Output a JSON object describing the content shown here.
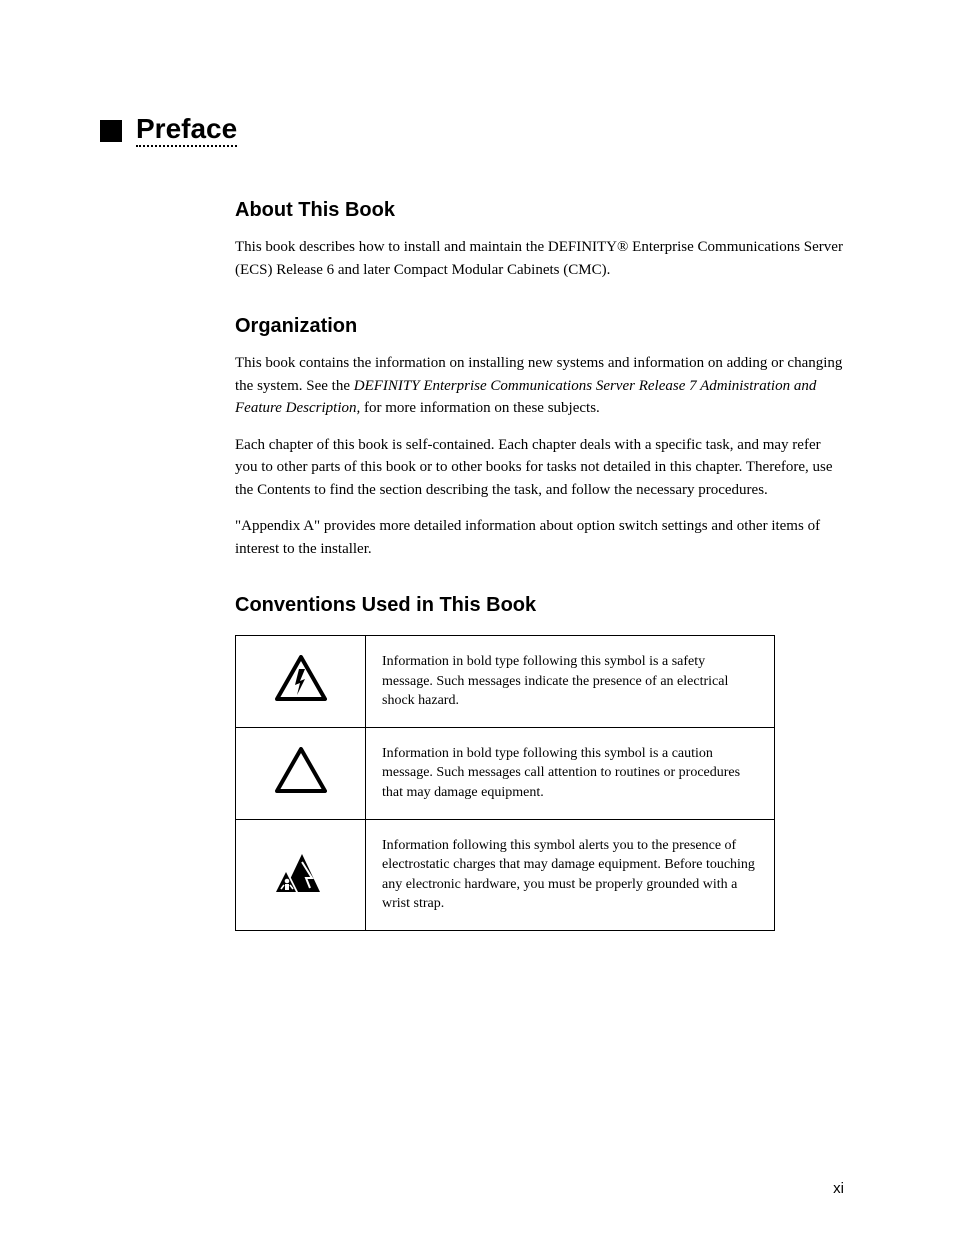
{
  "header": {
    "title": "Preface"
  },
  "intro": {
    "heading": "About This Book",
    "p1": "This book describes how to install and maintain the DEFINITY® Enterprise Communications Server (ECS) Release 6 and later Compact Modular Cabinets (CMC)."
  },
  "org": {
    "heading": "Organization",
    "p1_pre": "This book contains the information on installing new systems and information on adding or changing the system. See the ",
    "p1_em": "DEFINITY Enterprise Communications Server Release 7 Administration and Feature Description, ",
    "p1_post": "for more information on these subjects.",
    "p2_pre": "Each chapter of this book is self-contained. Each chapter deals with a specific task, and may refer you to other parts of this book or to other books for tasks not detailed in this chapter. Therefore, use the ",
    "p2_link": "Contents",
    "p2_post": " to find the section describing the task, and follow the necessary procedures.",
    "p3": "\"Appendix A\" provides more detailed information about option switch settings and other items of interest to the installer."
  },
  "conv": {
    "heading": "Conventions Used in This Book",
    "row1": "Information in bold type following this symbol is a safety message. Such messages indicate the presence of an electrical shock hazard.",
    "row2": "Information in bold type following this symbol is a caution message. Such messages call attention to routines or procedures that may damage equipment.",
    "row3": "Information following this symbol alerts you to the presence of electrostatic charges that may damage equipment. Before touching any electronic hardware, you must be properly grounded with a wrist strap."
  },
  "page_num": "xi"
}
